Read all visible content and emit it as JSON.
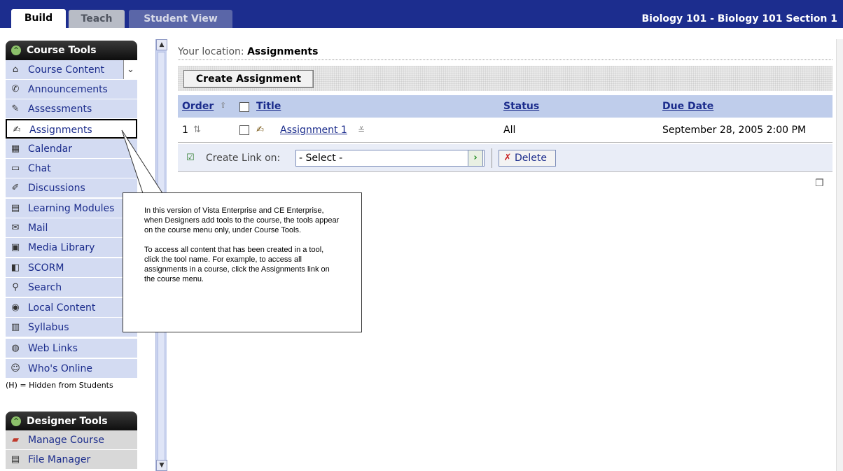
{
  "tabs": [
    {
      "label": "Build",
      "active": true
    },
    {
      "label": "Teach",
      "active": false
    },
    {
      "label": "Student View",
      "active": false
    }
  ],
  "course_title": "Biology 101 - Biology 101 Section 1",
  "course_tools": {
    "header": "Course Tools",
    "items": [
      {
        "label": "Course Content",
        "icon": "house-icon"
      },
      {
        "label": "Announcements",
        "icon": "megaphone-icon"
      },
      {
        "label": "Assessments",
        "icon": "assessment-icon"
      },
      {
        "label": "Assignments",
        "icon": "assignment-icon",
        "selected": true
      },
      {
        "label": "Calendar",
        "icon": "calendar-icon"
      },
      {
        "label": "Chat",
        "icon": "chat-icon"
      },
      {
        "label": "Discussions",
        "icon": "discussion-icon"
      },
      {
        "label": "Learning Modules",
        "icon": "module-icon"
      },
      {
        "label": "Mail",
        "icon": "mail-icon"
      },
      {
        "label": "Media Library",
        "icon": "media-icon"
      },
      {
        "label": "SCORM",
        "icon": "scorm-icon"
      },
      {
        "label": "Search",
        "icon": "search-icon"
      },
      {
        "label": "Local Content",
        "icon": "disc-icon"
      },
      {
        "label": "Syllabus",
        "icon": "syllabus-icon"
      },
      {
        "label": "Web Links",
        "icon": "globe-icon"
      },
      {
        "label": "Who's Online",
        "icon": "person-icon"
      }
    ],
    "note": "(H) = Hidden from Students"
  },
  "designer_tools": {
    "header": "Designer Tools",
    "items": [
      {
        "label": "Manage Course",
        "icon": "toolbox-icon"
      },
      {
        "label": "File Manager",
        "icon": "file-manager-icon"
      }
    ]
  },
  "location": {
    "prefix": "Your location:",
    "value": "Assignments"
  },
  "create_button": "Create Assignment",
  "table": {
    "headers": {
      "order": "Order",
      "title": "Title",
      "status": "Status",
      "due": "Due Date"
    },
    "rows": [
      {
        "order": "1",
        "title": "Assignment 1",
        "status": "All",
        "due": "September 28, 2005 2:00 PM"
      }
    ]
  },
  "actions": {
    "create_link_label": "Create Link on:",
    "select_value": "- Select -",
    "delete_label": "Delete"
  },
  "callout": {
    "paragraph1": "In this version of Vista Enterprise and CE Enterprise, when Designers add tools to the course, the tools appear on the course menu only, under Course Tools.",
    "paragraph2": "To access all content that has been created in a tool, click the tool name. For example, to access all assignments in a course, click the Assignments link on the course menu."
  },
  "colors": {
    "topbar": "#1c2d8e",
    "nav_bg": "#d3dbf2",
    "link": "#1b2c8c",
    "table_head": "#bfcdeb"
  }
}
